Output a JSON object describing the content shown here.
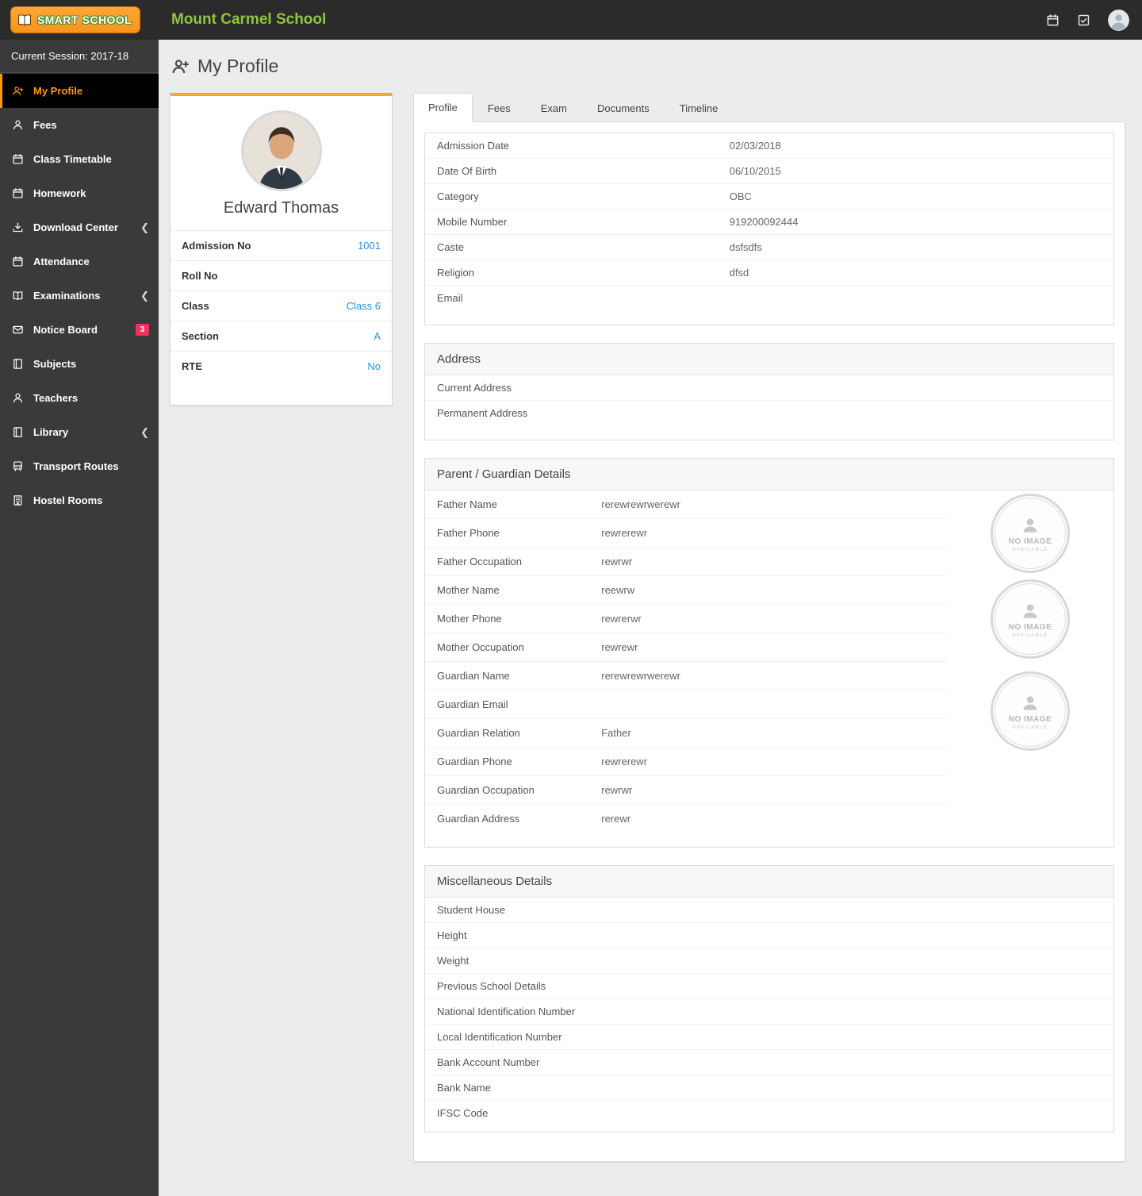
{
  "header": {
    "logo": {
      "smart": "SMART",
      "school": "SCHOOL"
    },
    "school_name": "Mount Carmel School"
  },
  "sidebar": {
    "session": "Current Session: 2017-18",
    "items": [
      {
        "label": "My Profile"
      },
      {
        "label": "Fees"
      },
      {
        "label": "Class Timetable"
      },
      {
        "label": "Homework"
      },
      {
        "label": "Download Center"
      },
      {
        "label": "Attendance"
      },
      {
        "label": "Examinations"
      },
      {
        "label": "Notice Board",
        "badge": "3"
      },
      {
        "label": "Subjects"
      },
      {
        "label": "Teachers"
      },
      {
        "label": "Library"
      },
      {
        "label": "Transport Routes"
      },
      {
        "label": "Hostel Rooms"
      }
    ]
  },
  "page": {
    "title": "My Profile"
  },
  "student_card": {
    "name": "Edward Thomas",
    "rows": [
      {
        "label": "Admission No",
        "value": "1001"
      },
      {
        "label": "Roll No",
        "value": ""
      },
      {
        "label": "Class",
        "value": "Class 6"
      },
      {
        "label": "Section",
        "value": "A"
      },
      {
        "label": "RTE",
        "value": "No"
      }
    ]
  },
  "tabs": [
    {
      "label": "Profile"
    },
    {
      "label": "Fees"
    },
    {
      "label": "Exam"
    },
    {
      "label": "Documents"
    },
    {
      "label": "Timeline"
    }
  ],
  "profile_tab": {
    "basic": [
      {
        "label": "Admission Date",
        "value": "02/03/2018"
      },
      {
        "label": "Date Of Birth",
        "value": "06/10/2015"
      },
      {
        "label": "Category",
        "value": "OBC"
      },
      {
        "label": "Mobile Number",
        "value": "919200092444"
      },
      {
        "label": "Caste",
        "value": "dsfsdfs"
      },
      {
        "label": "Religion",
        "value": "dfsd"
      },
      {
        "label": "Email",
        "value": ""
      }
    ],
    "address": {
      "title": "Address",
      "rows": [
        {
          "label": "Current Address",
          "value": ""
        },
        {
          "label": "Permanent Address",
          "value": ""
        }
      ]
    },
    "guardian": {
      "title": "Parent / Guardian Details",
      "no_image_line1": "NO IMAGE",
      "no_image_line2": "AVAILABLE",
      "father": [
        {
          "label": "Father Name",
          "value": "rerewrewrwerewr"
        },
        {
          "label": "Father Phone",
          "value": "rewrerewr"
        },
        {
          "label": "Father Occupation",
          "value": "rewrwr"
        }
      ],
      "mother": [
        {
          "label": "Mother Name",
          "value": "reewrw"
        },
        {
          "label": "Mother Phone",
          "value": "rewrerwr"
        },
        {
          "label": "Mother Occupation",
          "value": "rewrewr"
        }
      ],
      "guardian": [
        {
          "label": "Guardian Name",
          "value": "rerewrewrwerewr"
        },
        {
          "label": "Guardian Email",
          "value": ""
        },
        {
          "label": "Guardian Relation",
          "value": "Father"
        },
        {
          "label": "Guardian Phone",
          "value": "rewrerewr"
        },
        {
          "label": "Guardian Occupation",
          "value": "rewrwr"
        },
        {
          "label": "Guardian Address",
          "value": "rerewr"
        }
      ]
    },
    "misc": {
      "title": "Miscellaneous Details",
      "rows": [
        {
          "label": "Student House"
        },
        {
          "label": "Height"
        },
        {
          "label": "Weight"
        },
        {
          "label": "Previous School Details"
        },
        {
          "label": "National Identification Number"
        },
        {
          "label": "Local Identification Number"
        },
        {
          "label": "Bank Account Number"
        },
        {
          "label": "Bank Name"
        },
        {
          "label": "IFSC Code"
        }
      ]
    }
  },
  "colors": {
    "accent_orange": "#ff9800",
    "accent_green": "#8dc63f",
    "link_blue": "#2196f3",
    "badge_pink": "#f2315f"
  }
}
